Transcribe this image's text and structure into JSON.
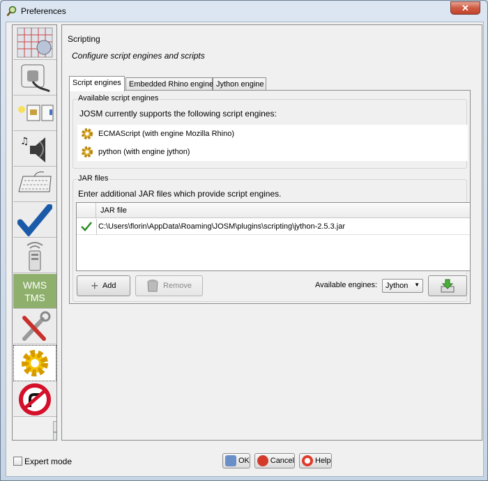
{
  "window": {
    "title": "Preferences",
    "close_glyph": "✕"
  },
  "sidebar": {
    "items": [
      {
        "icon": "map-grid-icon"
      },
      {
        "icon": "plug-icon"
      },
      {
        "icon": "folder-icon"
      },
      {
        "icon": "speaker-icon"
      },
      {
        "icon": "keyboard-icon"
      },
      {
        "icon": "checkmark-icon"
      },
      {
        "icon": "remote-icon"
      },
      {
        "icon": "wms-tms-icon",
        "label_top": "WMS",
        "label_bottom": "TMS"
      },
      {
        "icon": "tools-icon"
      },
      {
        "icon": "gear-icon",
        "selected": true
      },
      {
        "icon": "no-turn-icon"
      }
    ]
  },
  "main": {
    "section_title": "Scripting",
    "section_desc": "Configure script engines and scripts",
    "tabs": [
      {
        "label": "Script engines",
        "active": true
      },
      {
        "label": "Embedded Rhino engine"
      },
      {
        "label": "Jython engine"
      }
    ],
    "available": {
      "title": "Available script engines",
      "intro": "JOSM currently supports the following script engines:",
      "engines": [
        "ECMAScript (with engine Mozilla Rhino)",
        "python (with engine jython)"
      ]
    },
    "jar": {
      "title": "JAR files",
      "intro": "Enter additional JAR files which provide script engines.",
      "column": "JAR file",
      "rows": [
        {
          "valid": true,
          "path": "C:\\Users\\florin\\AppData\\Roaming\\JOSM\\plugins\\scripting\\jython-2.5.3.jar"
        }
      ],
      "add_label": "Add",
      "remove_label": "Remove",
      "engines_label": "Available engines:",
      "engines_value": "Jython"
    }
  },
  "footer": {
    "expert_label": "Expert mode",
    "ok_label": "OK",
    "cancel_label": "Cancel",
    "help_label": "Help"
  },
  "colors": {
    "title_bg": "#dce6f2",
    "close": "#c2432b",
    "check": "#2a8a1e"
  }
}
